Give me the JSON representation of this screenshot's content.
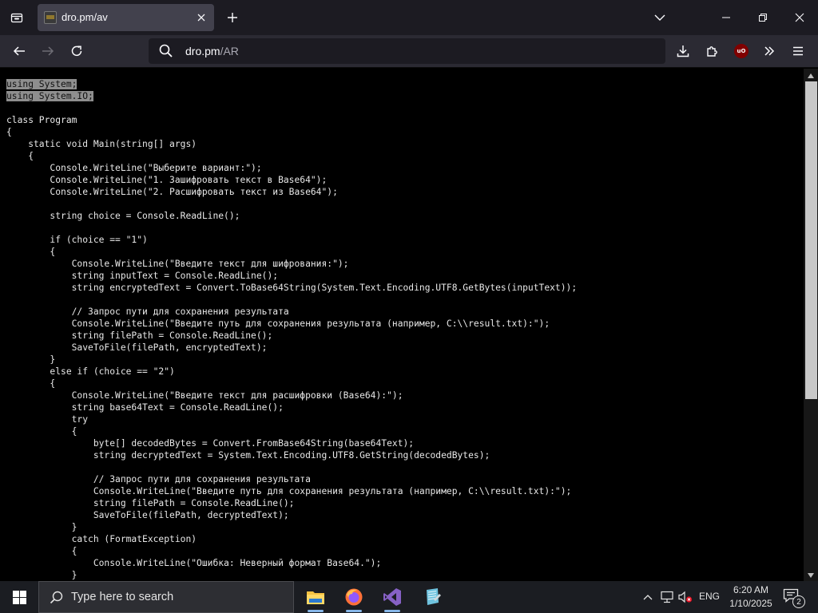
{
  "browser": {
    "tab": {
      "title": "dro.pm/av"
    },
    "url": {
      "host": "dro.pm",
      "path": "/AR"
    }
  },
  "code_lines": [
    "using System;",
    "using System.IO;",
    "",
    "class Program",
    "{",
    "    static void Main(string[] args)",
    "    {",
    "        Console.WriteLine(\"Выберите вариант:\");",
    "        Console.WriteLine(\"1. Зашифровать текст в Base64\");",
    "        Console.WriteLine(\"2. Расшифровать текст из Base64\");",
    "",
    "        string choice = Console.ReadLine();",
    "",
    "        if (choice == \"1\")",
    "        {",
    "            Console.WriteLine(\"Введите текст для шифрования:\");",
    "            string inputText = Console.ReadLine();",
    "            string encryptedText = Convert.ToBase64String(System.Text.Encoding.UTF8.GetBytes(inputText));",
    "",
    "            // Запрос пути для сохранения результата",
    "            Console.WriteLine(\"Введите путь для сохранения результата (например, C:\\\\result.txt):\");",
    "            string filePath = Console.ReadLine();",
    "            SaveToFile(filePath, encryptedText);",
    "        }",
    "        else if (choice == \"2\")",
    "        {",
    "            Console.WriteLine(\"Введите текст для расшифровки (Base64):\");",
    "            string base64Text = Console.ReadLine();",
    "            try",
    "            {",
    "                byte[] decodedBytes = Convert.FromBase64String(base64Text);",
    "                string decryptedText = System.Text.Encoding.UTF8.GetString(decodedBytes);",
    "",
    "                // Запрос пути для сохранения результата",
    "                Console.WriteLine(\"Введите путь для сохранения результата (например, C:\\\\result.txt):\");",
    "                string filePath = Console.ReadLine();",
    "                SaveToFile(filePath, decryptedText);",
    "            }",
    "            catch (FormatException)",
    "            {",
    "                Console.WriteLine(\"Ошибка: Неверный формат Base64.\");",
    "            }"
  ],
  "selected_line_count": 2,
  "taskbar": {
    "search_placeholder": "Type here to search",
    "apps": [
      "file-explorer-icon",
      "firefox-icon",
      "visual-studio-icon",
      "notepad-icon"
    ],
    "language": "ENG",
    "time": "6:20 AM",
    "date": "1/10/2025",
    "notification_count": "2"
  },
  "colors": {
    "tab_strip": "#1c1b22",
    "nav_bar": "#2b2a33",
    "url_field": "#1c1b22",
    "active_tab": "#42414d",
    "page_background": "#000000",
    "selection": "#8e8e8e",
    "taskbar": "#1b1d22"
  }
}
